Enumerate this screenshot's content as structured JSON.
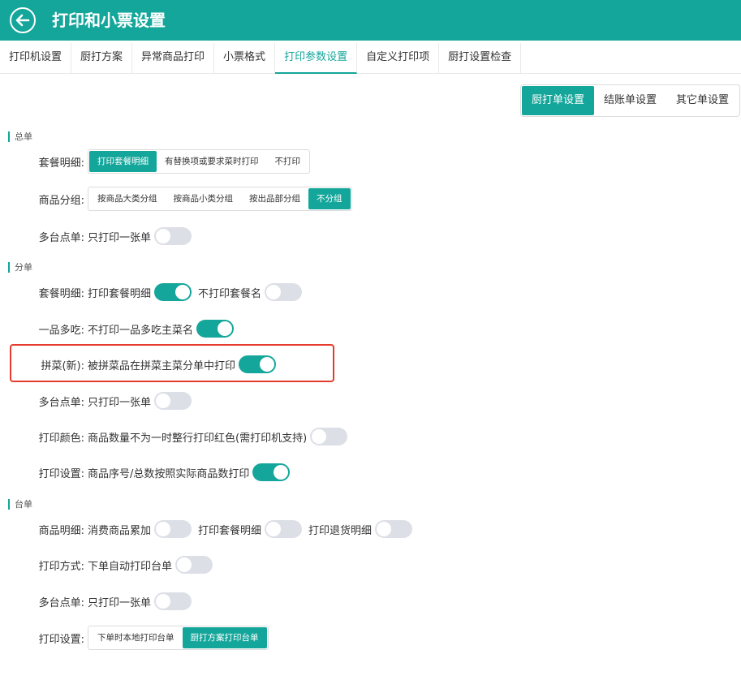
{
  "header": {
    "title": "打印和小票设置",
    "back_icon": "back-arrow-icon"
  },
  "tabs": [
    "打印机设置",
    "厨打方案",
    "异常商品打印",
    "小票格式",
    "打印参数设置",
    "自定义打印项",
    "厨打设置检查"
  ],
  "active_tab": "打印参数设置",
  "subtabs": [
    "厨打单设置",
    "结账单设置",
    "其它单设置"
  ],
  "active_subtab": "厨打单设置",
  "accent_color": "#14a69a",
  "highlight_color": "#e53b2d",
  "sections": {
    "zongdan": {
      "title": "总单",
      "combo_detail": {
        "label": "套餐明细:",
        "options": [
          "打印套餐明细",
          "有替换项或要求菜时打印",
          "不打印"
        ],
        "selected": "打印套餐明细"
      },
      "goods_group": {
        "label": "商品分组:",
        "options": [
          "按商品大类分组",
          "按商品小类分组",
          "按出品部分组",
          "不分组"
        ],
        "selected": "不分组"
      },
      "multi_table": {
        "label": "多台点单:",
        "text": "只打印一张单",
        "on": false
      }
    },
    "fendan": {
      "title": "分单",
      "combo_detail": {
        "label": "套餐明细:",
        "text1": "打印套餐明细",
        "on1": true,
        "text2": "不打印套餐名",
        "on2": false
      },
      "one_item_multi": {
        "label": "一品多吃:",
        "text": "不打印一品多吃主菜名",
        "on": true
      },
      "pincai": {
        "label": "拼菜(新):",
        "text": "被拼菜品在拼菜主菜分单中打印",
        "on": true
      },
      "multi_table": {
        "label": "多台点单:",
        "text": "只打印一张单",
        "on": false
      },
      "print_color": {
        "label": "打印颜色:",
        "text": "商品数量不为一时整行打印红色(需打印机支持)",
        "on": false
      },
      "print_setting": {
        "label": "打印设置:",
        "text": "商品序号/总数按照实际商品数打印",
        "on": true
      }
    },
    "taidan": {
      "title": "台单",
      "goods_detail": {
        "label": "商品明细:",
        "text1": "消费商品累加",
        "on1": false,
        "text2": "打印套餐明细",
        "on2": false,
        "text3": "打印退货明细",
        "on3": false
      },
      "print_mode": {
        "label": "打印方式:",
        "text": "下单自动打印台单",
        "on": false
      },
      "multi_table": {
        "label": "多台点单:",
        "text": "只打印一张单",
        "on": false
      },
      "print_setting": {
        "label": "打印设置:",
        "options": [
          "下单时本地打印台单",
          "厨打方案打印台单"
        ],
        "selected": "厨打方案打印台单"
      }
    }
  }
}
